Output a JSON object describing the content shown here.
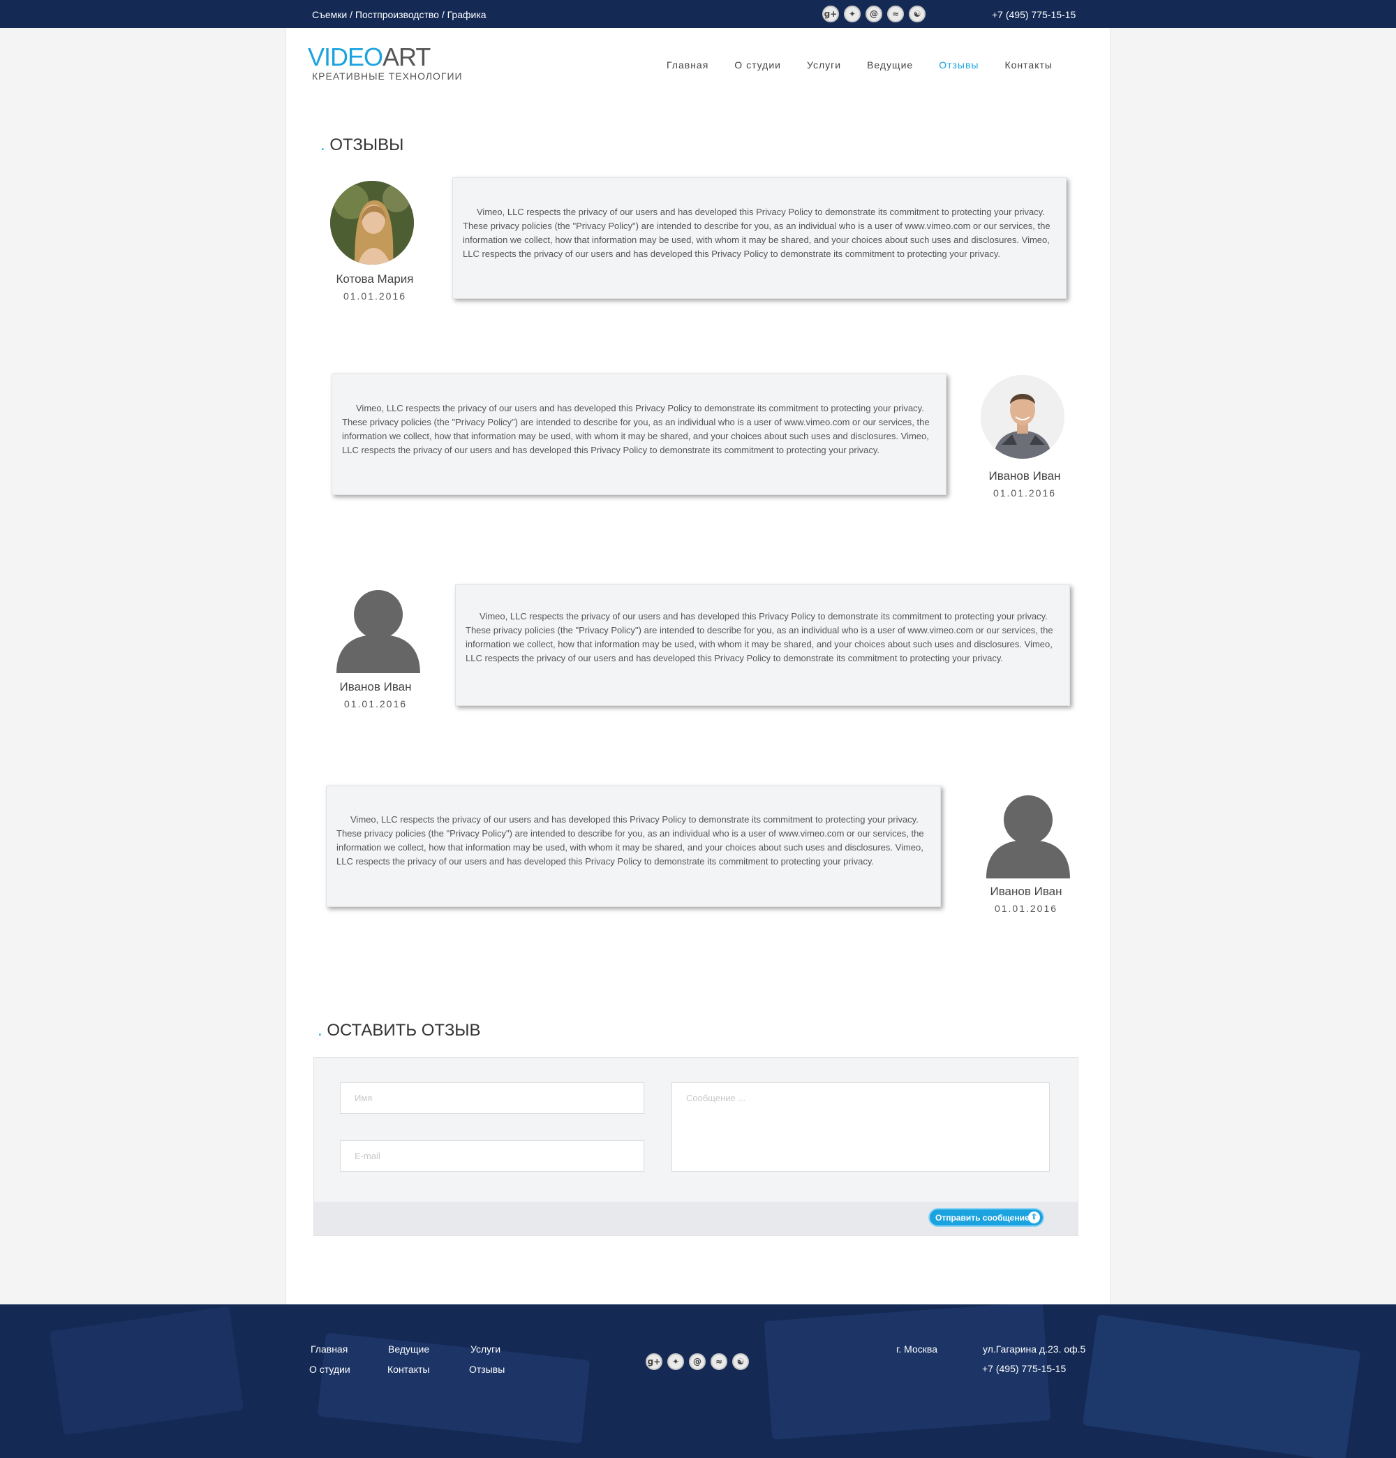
{
  "topbar": {
    "tagline": "Съемки / Постпроизводство / Графика",
    "phone": "+7 (495) 775-15-15",
    "social_icons": [
      "google-plus-icon",
      "twitter-icon",
      "email-icon",
      "rss-icon",
      "odnoklassniki-icon"
    ]
  },
  "logo": {
    "part1": "VIDEO",
    "part2": "ART",
    "slogan": "КРЕАТИВНЫЕ ТЕХНОЛОГИИ"
  },
  "nav": [
    {
      "label": "Главная",
      "active": false
    },
    {
      "label": "О студии",
      "active": false
    },
    {
      "label": "Услуги",
      "active": false
    },
    {
      "label": "Ведущие",
      "active": false
    },
    {
      "label": "Отзывы",
      "active": true
    },
    {
      "label": "Контакты",
      "active": false
    }
  ],
  "reviews_section": {
    "dot": ".",
    "title": "ОТЗЫВЫ"
  },
  "reviews": [
    {
      "name": "Котова Мария",
      "date": "01.01.2016",
      "avatar": "photo-woman",
      "text": "Vimeo, LLC respects the privacy of our users and has developed this Privacy Policy to demonstrate its commitment to protecting your privacy. These privacy policies (the \"Privacy Policy\") are intended to describe for you, as an individual who is a user of www.vimeo.com or our services, the information we collect, how that information may be used, with whom it may be shared, and your choices about such uses and disclosures. Vimeo, LLC respects the privacy of our users and has developed this Privacy Policy to demonstrate its commitment to protecting your privacy."
    },
    {
      "name": "Иванов Иван",
      "date": "01.01.2016",
      "avatar": "photo-man",
      "text": "Vimeo, LLC respects the privacy of our users and has developed this Privacy Policy to demonstrate its commitment to protecting your privacy. These privacy policies (the \"Privacy Policy\") are intended to describe for you, as an individual who is a user of www.vimeo.com or our services, the information we collect, how that information may be used, with whom it may be shared, and your choices about such uses and disclosures. Vimeo, LLC respects the privacy of our users and has developed this Privacy Policy to demonstrate its commitment to protecting your privacy."
    },
    {
      "name": "Иванов Иван",
      "date": "01.01.2016",
      "avatar": "placeholder-user",
      "text": "Vimeo, LLC respects the privacy of our users and has developed this Privacy Policy to demonstrate its commitment to protecting your privacy. These privacy policies (the \"Privacy Policy\") are intended to describe for you, as an individual who is a user of www.vimeo.com or our services, the information we collect, how that information may be used, with whom it may be shared, and your choices about such uses and disclosures. Vimeo, LLC respects the privacy of our users and has developed this Privacy Policy to demonstrate its commitment to protecting your privacy."
    },
    {
      "name": "Иванов Иван",
      "date": "01.01.2016",
      "avatar": "placeholder-user",
      "text": "Vimeo, LLC respects the privacy of our users and has developed this Privacy Policy to demonstrate its commitment to protecting your privacy. These privacy policies (the \"Privacy Policy\") are intended to describe for you, as an individual who is a user of www.vimeo.com or our services, the information we collect, how that information may be used, with whom it may be shared, and your choices about such uses and disclosures. Vimeo, LLC respects the privacy of our users and has developed this Privacy Policy to demonstrate its commitment to protecting your privacy."
    }
  ],
  "form_section": {
    "dot": ".",
    "title": "ОСТАВИТЬ ОТЗЫВ"
  },
  "form": {
    "name_placeholder": "Имя",
    "email_placeholder": "E-mail",
    "message_placeholder": "Сообщение ...",
    "send_label": "Отправить сообщение",
    "send_icon": "upload-arrow-icon"
  },
  "footer": {
    "links": [
      "Главная",
      "О студии",
      "Ведущие",
      "Контакты",
      "Услуги",
      "Отзывы"
    ],
    "city": "г. Москва",
    "address": "ул.Гагарина д.23. оф.5",
    "phone": "+7 (495) 775-15-15"
  },
  "colors": {
    "accent": "#1ba3e0",
    "dark_navy": "#142a55",
    "card_bg": "#f3f4f6"
  }
}
